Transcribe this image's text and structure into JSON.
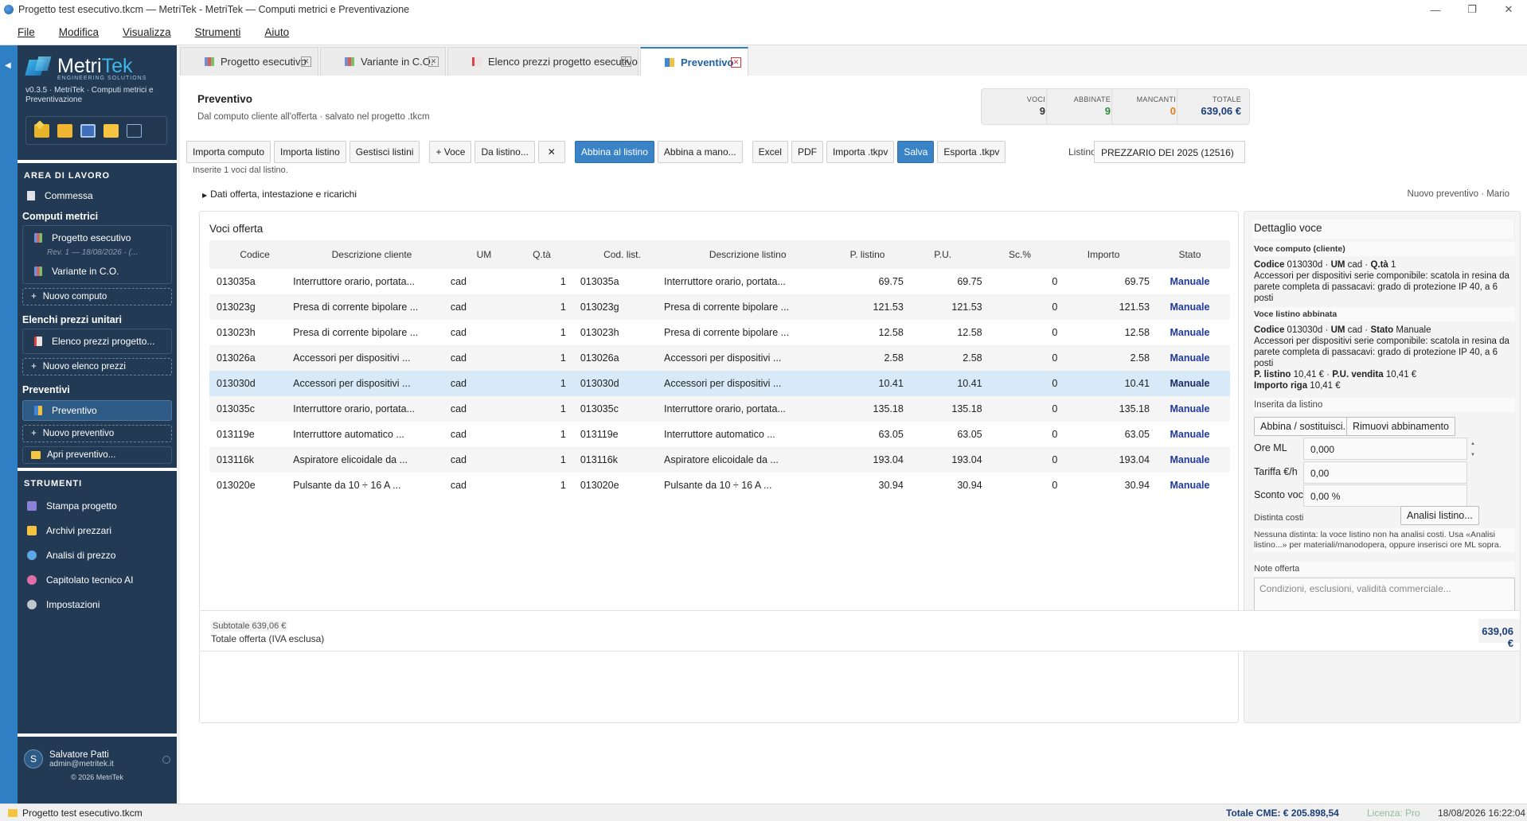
{
  "window": {
    "title": "Progetto test esecutivo.tkcm — MetriTek - MetriTek — Computi metrici e Preventivazione",
    "controls": [
      "—",
      "❐",
      "✕"
    ]
  },
  "menu": [
    "File",
    "Modifica",
    "Visualizza",
    "Strumenti",
    "Aiuto"
  ],
  "sidebar": {
    "logo_main": "Metri",
    "logo_accent": "Tek",
    "logo_sub": "ENGINEERING SOLUTIONS",
    "version": "v0.3.5 · MetriTek · Computi metrici e Preventivazione",
    "section_work": "AREA DI LAVORO",
    "commessa": "Commessa",
    "computi_title": "Computi metrici",
    "computi": [
      "Progetto esecutivo",
      "Variante in C.O."
    ],
    "rev_text": "Rev. 1 — 18/08/2026 · (...",
    "new_computo": "Nuovo computo",
    "elenchi_title": "Elenchi prezzi unitari",
    "elenco": "Elenco prezzi progetto...",
    "new_elenco": "Nuovo elenco prezzi",
    "preventivi_title": "Preventivi",
    "preventivo": "Preventivo",
    "new_preventivo": "Nuovo preventivo",
    "open_preventivo": "Apri preventivo...",
    "section_tools": "STRUMENTI",
    "tools": [
      "Stampa progetto",
      "Archivi prezzari",
      "Analisi di prezzo",
      "Capitolato tecnico AI",
      "Impostazioni"
    ],
    "user_initial": "S",
    "user_name": "Salvatore Patti",
    "user_mail": "admin@metritek.it",
    "copyright": "© 2026 MetriTek"
  },
  "tabs": [
    {
      "label": "Progetto esecutivo"
    },
    {
      "label": "Variante in C.O."
    },
    {
      "label": "Elenco prezzi progetto esecutivo"
    },
    {
      "label": "Preventivo"
    }
  ],
  "header": {
    "title": "Preventivo",
    "subtitle": "Dal computo cliente all'offerta · salvato nel progetto .tkcm"
  },
  "kpis": [
    {
      "label": "VOCI",
      "value": "9",
      "color": "#333333"
    },
    {
      "label": "ABBINATE",
      "value": "9",
      "color": "#2e8b3a"
    },
    {
      "label": "MANCANTI",
      "value": "0",
      "color": "#e07b1a"
    },
    {
      "label": "TOTALE",
      "value": "639,06 €",
      "color": "#1b3e7a"
    }
  ],
  "toolbar": {
    "importa_computo": "Importa computo",
    "importa_listino": "Importa listino",
    "gestisci_listini": "Gestisci listini",
    "voce": "+ Voce",
    "da_listino": "Da listino...",
    "clear": "✕",
    "abbina_listino": "Abbina al listino",
    "abbina_mano": "Abbina a mano...",
    "excel": "Excel",
    "pdf": "PDF",
    "importa_tkpv": "Importa .tkpv",
    "salva": "Salva",
    "esporta_tkpv": "Esporta .tkpv",
    "listino_label": "Listino",
    "listino_value": "PREZZARIO DEI 2025 (12516)"
  },
  "status_msg": "Inserite 1 voci dal listino.",
  "collapse_label": "Dati offerta, intestazione e ricarichi",
  "meta_right": "Nuovo preventivo · Mario",
  "offer": {
    "title": "Voci offerta",
    "columns": [
      "Codice",
      "Descrizione cliente",
      "UM",
      "Q.tà",
      "Cod. list.",
      "Descrizione listino",
      "P. listino",
      "P.U.",
      "Sc.%",
      "Importo",
      "Stato"
    ],
    "rows": [
      {
        "codice": "013035a",
        "desc": "Interruttore orario, portata...",
        "um": "cad",
        "qta": "1",
        "codl": "013035a",
        "descl": "Interruttore orario, portata...",
        "pl": "69.75",
        "pu": "69.75",
        "sc": "0",
        "imp": "69.75",
        "stato": "Manuale"
      },
      {
        "codice": "013023g",
        "desc": "Presa di corrente bipolare ...",
        "um": "cad",
        "qta": "1",
        "codl": "013023g",
        "descl": "Presa di corrente bipolare ...",
        "pl": "121.53",
        "pu": "121.53",
        "sc": "0",
        "imp": "121.53",
        "stato": "Manuale"
      },
      {
        "codice": "013023h",
        "desc": "Presa di corrente bipolare ...",
        "um": "cad",
        "qta": "1",
        "codl": "013023h",
        "descl": "Presa di corrente bipolare ...",
        "pl": "12.58",
        "pu": "12.58",
        "sc": "0",
        "imp": "12.58",
        "stato": "Manuale"
      },
      {
        "codice": "013026a",
        "desc": "Accessori per dispositivi ...",
        "um": "cad",
        "qta": "1",
        "codl": "013026a",
        "descl": "Accessori per dispositivi ...",
        "pl": "2.58",
        "pu": "2.58",
        "sc": "0",
        "imp": "2.58",
        "stato": "Manuale"
      },
      {
        "codice": "013030d",
        "desc": "Accessori per dispositivi ...",
        "um": "cad",
        "qta": "1",
        "codl": "013030d",
        "descl": "Accessori per dispositivi ...",
        "pl": "10.41",
        "pu": "10.41",
        "sc": "0",
        "imp": "10.41",
        "stato": "Manuale"
      },
      {
        "codice": "013035c",
        "desc": "Interruttore orario, portata...",
        "um": "cad",
        "qta": "1",
        "codl": "013035c",
        "descl": "Interruttore orario, portata...",
        "pl": "135.18",
        "pu": "135.18",
        "sc": "0",
        "imp": "135.18",
        "stato": "Manuale"
      },
      {
        "codice": "013119e",
        "desc": "Interruttore automatico ...",
        "um": "cad",
        "qta": "1",
        "codl": "013119e",
        "descl": "Interruttore automatico ...",
        "pl": "63.05",
        "pu": "63.05",
        "sc": "0",
        "imp": "63.05",
        "stato": "Manuale"
      },
      {
        "codice": "013116k",
        "desc": "Aspiratore elicoidale da ...",
        "um": "cad",
        "qta": "1",
        "codl": "013116k",
        "descl": "Aspiratore elicoidale da ...",
        "pl": "193.04",
        "pu": "193.04",
        "sc": "0",
        "imp": "193.04",
        "stato": "Manuale"
      },
      {
        "codice": "013020e",
        "desc": "Pulsante da 10 ÷ 16 A ...",
        "um": "cad",
        "qta": "1",
        "codl": "013020e",
        "descl": "Pulsante da 10 ÷ 16 A ...",
        "pl": "30.94",
        "pu": "30.94",
        "sc": "0",
        "imp": "30.94",
        "stato": "Manuale"
      }
    ]
  },
  "detail": {
    "title": "Dettaglio voce",
    "sec_computo": "Voce computo (cliente)",
    "computo_line_a": "Codice",
    "computo_cod": "013030d",
    "computo_line_b": "UM",
    "computo_um": "cad",
    "computo_line_c": "Q.tà",
    "computo_qta": "1",
    "computo_desc": "Accessori per dispositivi serie componibile: scatola in resina da parete completa di passacavi: grado di protezione IP 40, a 6 posti",
    "sec_listino": "Voce listino abbinata",
    "listino_stato_label": "Stato",
    "listino_stato": "Manuale",
    "listino_desc": "Accessori per dispositivi serie componibile: scatola in resina da parete completa di passacavi: grado di protezione IP 40, a 6 posti",
    "pl_label": "P. listino",
    "pl_value": "10,41 €",
    "pv_label": "P.U. vendita",
    "pv_value": "10,41 €",
    "imp_label": "Importo riga",
    "imp_value": "10,41 €",
    "inserted": "Inserita da listino",
    "btn_abbina": "Abbina / sostituisci...",
    "btn_rimuovi": "Rimuovi abbinamento",
    "ore_label": "Ore ML",
    "ore_value": "0,000",
    "tariffa_label": "Tariffa €/h",
    "tariffa_value": "0,00",
    "sconto_label": "Sconto voce",
    "sconto_value": "0,00 %",
    "distinta_label": "Distinta costi",
    "btn_analisi": "Analisi listino...",
    "distinta_note": "Nessuna distinta: la voce listino non ha analisi costi. Usa «Analisi listino...» per materiali/manodopera, oppure inserisci ore ML sopra.",
    "note_label": "Note offerta",
    "note_placeholder": "Condizioni, esclusioni, validità commerciale..."
  },
  "totals": {
    "subtotal": "Subtotale 639,06 €",
    "label": "Totale offerta (IVA esclusa)",
    "value": "639,06 €"
  },
  "statusbar": {
    "file": "Progetto test esecutivo.tkcm",
    "total": "Totale CME: € 205.898,54",
    "license": "Licenza: Pro",
    "datetime": "18/08/2026   16:22:04"
  }
}
